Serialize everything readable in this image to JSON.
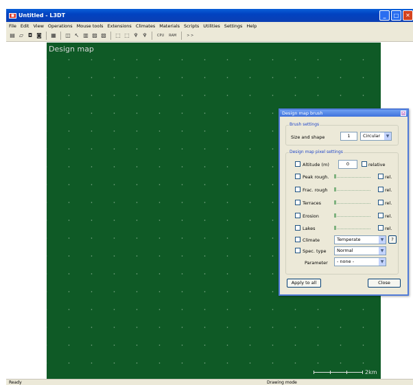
{
  "window": {
    "title": "Untitled - L3DT",
    "app_icon": "l3dt-app-icon",
    "controls": [
      "minimize-icon",
      "maximize-icon",
      "close-icon"
    ]
  },
  "menu": [
    "File",
    "Edit",
    "View",
    "Operations",
    "Mouse tools",
    "Extensions",
    "Climates",
    "Materials",
    "Scripts",
    "Utilities",
    "Settings",
    "Help"
  ],
  "toolbar": {
    "cpu_label": "CPU",
    "ram_label": "RAM",
    "more_label": "> >"
  },
  "map": {
    "title": "Design map",
    "scale_label": "2km",
    "background_color": "#0f5a26"
  },
  "dialog": {
    "title": "Design map brush",
    "brush_group": "Brush settings",
    "size_shape_label": "Size and shape",
    "size_value": "1",
    "shape_value": "Circular",
    "pixel_group": "Design map pixel settings",
    "altitude_label": "Altitude (m)",
    "altitude_value": "0",
    "relative_label": "relative",
    "peak_rough_label": "Peak rough.",
    "frac_rough_label": "Frac. rough",
    "terraces_label": "Terraces",
    "erosion_label": "Erosion",
    "lakes_label": "Lakes",
    "rel_label": "rel.",
    "climate_label": "Climate",
    "climate_value": "Temperate",
    "help_label": "?",
    "spec_type_label": "Spec. type",
    "spec_type_value": "Normal",
    "parameter_label": "Parameter",
    "parameter_value": "- none -",
    "apply_button": "Apply to all",
    "close_button": "Close"
  },
  "status": {
    "left": "Ready",
    "mode": "Drawing mode"
  }
}
